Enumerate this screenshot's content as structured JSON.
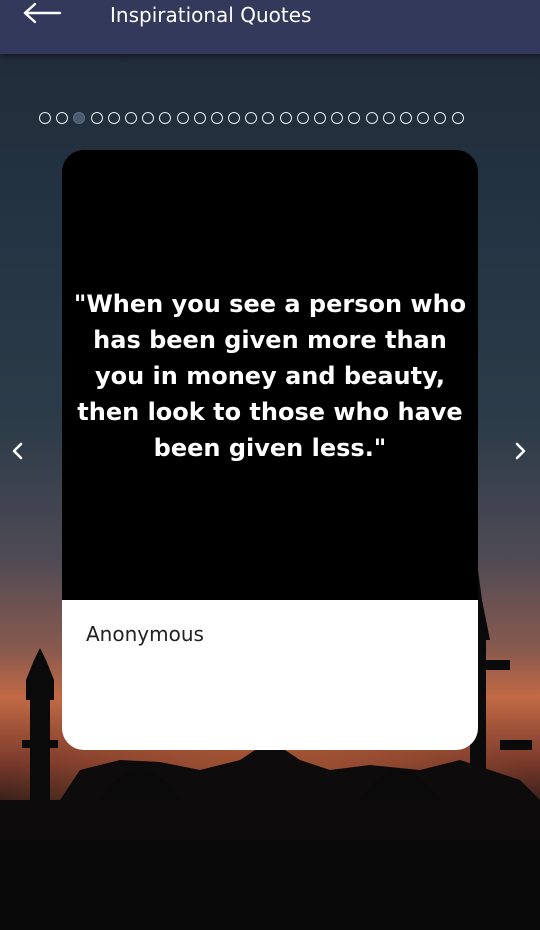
{
  "header": {
    "title": "Inspirational Quotes",
    "back_icon": "arrow-left-icon"
  },
  "pagination": {
    "total": 25,
    "active_index": 2
  },
  "quote": {
    "text": "\"When you see a person who has been given more than you in money and beauty, then look to those who have been given less.\"",
    "author": "Anonymous"
  },
  "navigation": {
    "prev_icon": "chevron-left-icon",
    "next_icon": "chevron-right-icon"
  },
  "colors": {
    "appbar": "#33395a",
    "card_top": "#000000",
    "card_bottom": "#ffffff"
  }
}
